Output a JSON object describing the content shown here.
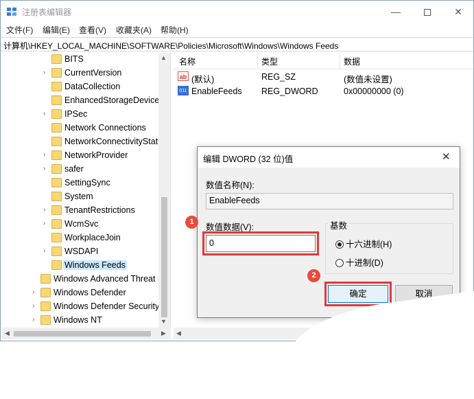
{
  "window": {
    "title": "注册表编辑器"
  },
  "menu": [
    "文件(F)",
    "编辑(E)",
    "查看(V)",
    "收藏夹(A)",
    "帮助(H)"
  ],
  "address": "计算机\\HKEY_LOCAL_MACHINE\\SOFTWARE\\Policies\\Microsoft\\Windows\\Windows Feeds",
  "tree": [
    {
      "label": "BITS",
      "chevron": ""
    },
    {
      "label": "CurrentVersion",
      "chevron": "›"
    },
    {
      "label": "DataCollection",
      "chevron": ""
    },
    {
      "label": "EnhancedStorageDevices",
      "chevron": ""
    },
    {
      "label": "IPSec",
      "chevron": "›"
    },
    {
      "label": "Network Connections",
      "chevron": ""
    },
    {
      "label": "NetworkConnectivityStatusIndicator",
      "chevron": ""
    },
    {
      "label": "NetworkProvider",
      "chevron": "›"
    },
    {
      "label": "safer",
      "chevron": "›"
    },
    {
      "label": "SettingSync",
      "chevron": ""
    },
    {
      "label": "System",
      "chevron": ""
    },
    {
      "label": "TenantRestrictions",
      "chevron": "›"
    },
    {
      "label": "WcmSvc",
      "chevron": "›"
    },
    {
      "label": "WorkplaceJoin",
      "chevron": ""
    },
    {
      "label": "WSDAPI",
      "chevron": "›"
    },
    {
      "label": "Windows Feeds",
      "chevron": ""
    },
    {
      "label": "Windows Advanced Threat Protection",
      "chevron": ""
    },
    {
      "label": "Windows Defender",
      "chevron": "›"
    },
    {
      "label": "Windows Defender Security Center",
      "chevron": "›"
    },
    {
      "label": "Windows NT",
      "chevron": "›"
    }
  ],
  "list": {
    "headers": [
      "名称",
      "类型",
      "数据"
    ],
    "rows": [
      {
        "icon": "ab",
        "name": "(默认)",
        "type": "REG_SZ",
        "data": "(数值未设置)"
      },
      {
        "icon": "011",
        "name": "EnableFeeds",
        "type": "REG_DWORD",
        "data": "0x00000000 (0)"
      }
    ]
  },
  "dialog": {
    "title": "编辑 DWORD (32 位)值",
    "name_label": "数值名称(N):",
    "name_value": "EnableFeeds",
    "data_label": "数值数据(V):",
    "data_value": "0",
    "base_label": "基数",
    "radio_hex": "十六进制(H)",
    "radio_dec": "十进制(D)",
    "ok": "确定",
    "cancel": "取消"
  },
  "badges": [
    "1",
    "2"
  ],
  "colors": {
    "highlight": "#e03a3a",
    "badge": "#e84b3c",
    "folder": "#f8d775",
    "selection": "#cce8ff"
  }
}
